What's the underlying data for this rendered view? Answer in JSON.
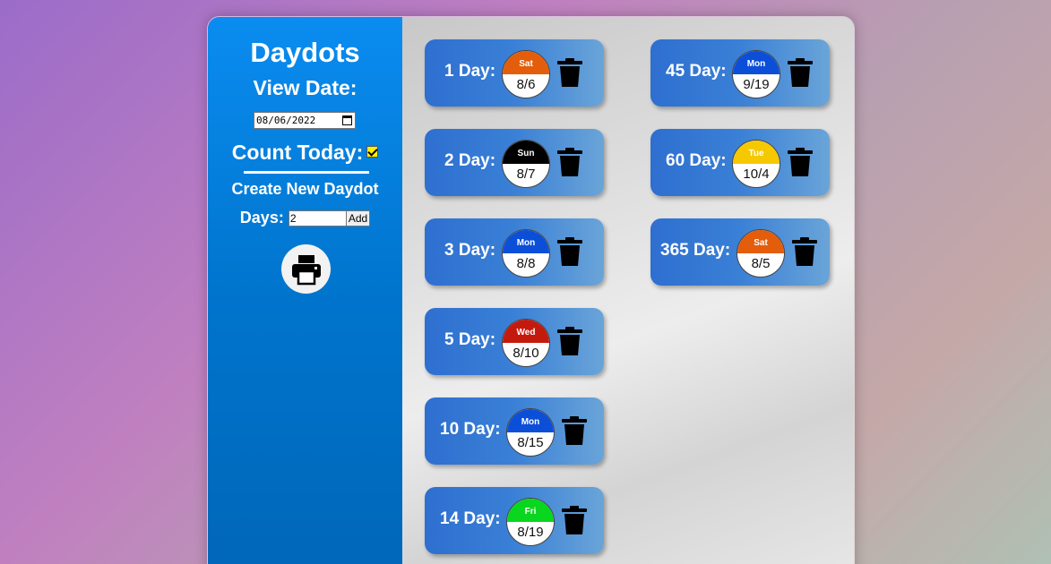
{
  "app": {
    "title": "Daydots",
    "view_date_label": "View Date:",
    "view_date_value": "08/06/2022",
    "count_today_label": "Count Today:",
    "count_today_checked": true,
    "create_label": "Create New Daydot",
    "days_label": "Days:",
    "days_value": "2",
    "add_label": "Add",
    "print_icon": "print-icon"
  },
  "colors": {
    "sat": "#e35d0b",
    "sun": "#000000",
    "mon": "#0b4fd9",
    "tue": "#f5c800",
    "wed": "#c41a0e",
    "fri": "#08d61f"
  },
  "daydots": [
    {
      "label": "1 Day:",
      "weekday": "Sat",
      "date": "8/6",
      "color": "#e35d0b"
    },
    {
      "label": "2 Day:",
      "weekday": "Sun",
      "date": "8/7",
      "color": "#000000"
    },
    {
      "label": "3 Day:",
      "weekday": "Mon",
      "date": "8/8",
      "color": "#0b4fd9"
    },
    {
      "label": "5 Day:",
      "weekday": "Wed",
      "date": "8/10",
      "color": "#c41a0e"
    },
    {
      "label": "10 Day:",
      "weekday": "Mon",
      "date": "8/15",
      "color": "#0b4fd9"
    },
    {
      "label": "14 Day:",
      "weekday": "Fri",
      "date": "8/19",
      "color": "#08d61f"
    },
    {
      "label": "45 Day:",
      "weekday": "Mon",
      "date": "9/19",
      "color": "#0b4fd9"
    },
    {
      "label": "60 Day:",
      "weekday": "Tue",
      "date": "10/4",
      "color": "#f5c800"
    },
    {
      "label": "365 Day:",
      "weekday": "Sat",
      "date": "8/5",
      "color": "#e35d0b"
    }
  ]
}
